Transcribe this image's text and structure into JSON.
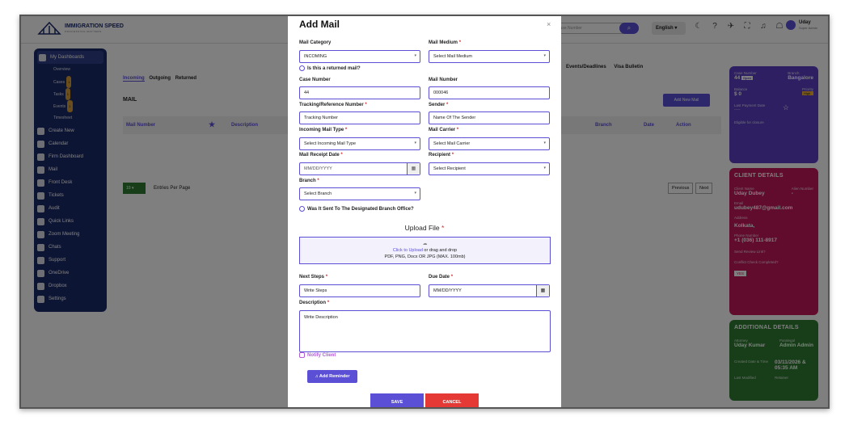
{
  "app": {
    "logo_text": "IMMIGRATION SPEED",
    "logo_sub": "PROCESSING MATTERS",
    "search_placeholder": "Case Number",
    "language": "English",
    "user_name": "Uday",
    "user_role": "Super Admin"
  },
  "sidebar": {
    "items": [
      {
        "label": "My Dashboards"
      },
      {
        "label": "Create New"
      },
      {
        "label": "Calendar"
      },
      {
        "label": "Firm Dashboard"
      },
      {
        "label": "Mail"
      },
      {
        "label": "Front Desk"
      },
      {
        "label": "Tickets"
      },
      {
        "label": "Audit"
      },
      {
        "label": "Quick Links"
      },
      {
        "label": "Zoom Meeting"
      },
      {
        "label": "Chats"
      },
      {
        "label": "Support"
      },
      {
        "label": "OneDrive"
      },
      {
        "label": "Dropbox"
      },
      {
        "label": "Settings"
      }
    ],
    "subitems": [
      {
        "label": "Overview",
        "badge": ""
      },
      {
        "label": "Cases",
        "badge": "1"
      },
      {
        "label": "Tasks",
        "badge": "1"
      },
      {
        "label": "Events",
        "badge": "1"
      },
      {
        "label": "Timesheet",
        "badge": ""
      }
    ]
  },
  "main": {
    "tabs": [
      "Incoming",
      "Outgoing",
      "Returned"
    ],
    "section_title": "MAIL",
    "add_button": "Add New Mail",
    "headers": [
      "Mail Number",
      "Description",
      "Branch",
      "Date",
      "Action"
    ],
    "page_size": "10",
    "entries_label": "Entries Per Page",
    "prev": "Previous",
    "next": "Next",
    "top_tabs": [
      "Events/Deadlines",
      "Visa Bulletin"
    ]
  },
  "case_card": {
    "case_number_label": "Case Number",
    "case_number": "44",
    "status": "Open",
    "branch_label": "Branch",
    "branch": "Bangalore",
    "balance_label": "Balance",
    "balance": "$ 0",
    "priority_label": "Priority",
    "priority": "High",
    "last_payment_label": "Last Payment Date",
    "last_payment": "-----",
    "closure": "Eligible for closure"
  },
  "client_card": {
    "title": "CLIENT DETAILS",
    "name_label": "Client Name",
    "name": "Uday Dubey",
    "alien_label": "Alien Number",
    "alien": "-",
    "email_label": "Email",
    "email": "udubey487@gmail.com",
    "address_label": "Address",
    "address": "Kolkata,",
    "phone_label": "Phone Number",
    "phone": "+1 (036) 111-8917",
    "review": "Send Review Link?",
    "conflict": "Conflict Check Completed?",
    "conflict_value": "YES"
  },
  "additional_card": {
    "title": "ADDITIONAL DETAILS",
    "attorney_label": "Attorney",
    "attorney": "Uday Kumar",
    "paralegal_label": "Paralegal",
    "paralegal": "Admin Admin",
    "created_label": "Created Date & Time",
    "created": "03/11/2026 & 05:35 AM",
    "modified_label": "Last Modified",
    "modified_right": "Retainer"
  },
  "modal": {
    "title": "Add Mail",
    "mail_category_label": "Mail Category",
    "mail_category": "INCOMING",
    "mail_medium_label": "Mail Medium",
    "mail_medium": "Select Mail Medium",
    "returned_check": "Is this a returned mail?",
    "case_number_label": "Case Number",
    "case_number": "44",
    "mail_number_label": "Mail Number",
    "mail_number": "000046",
    "tracking_label": "Tracking/Reference Number",
    "tracking_placeholder": "Tracking Number",
    "sender_label": "Sender",
    "sender_placeholder": "Name Of The Sender",
    "incoming_type_label": "Incoming Mail Type",
    "incoming_type": "Select Incoming Mail Type",
    "carrier_label": "Mail Carrier",
    "carrier": "Select Mail Carrier",
    "receipt_date_label": "Mail Receipt Date",
    "receipt_date_placeholder": "MM/DD/YYYY",
    "recipient_label": "Recipient",
    "recipient": "Select Recipient",
    "branch_label": "Branch",
    "branch": "Select Branch",
    "branch_check": "Was It Sent To The Designated Branch Office?",
    "upload_title": "Upload File",
    "upload_link": "Click to Upload",
    "upload_text": " or drag and drop",
    "upload_formats": "PDF, PNG, Docx OR JPG (MAX. 100mb)",
    "next_steps_label": "Next Steps",
    "next_steps_placeholder": "Write Steps",
    "due_date_label": "Due Date",
    "due_date_placeholder": "MM/DD/YYYY",
    "description_label": "Description",
    "description_placeholder": "Write Description",
    "notify": "Notify Client",
    "add_reminder": "Add Reminder",
    "save": "SAVE",
    "cancel": "CANCEL",
    "req_mark": "*"
  },
  "colors": {
    "accent": "#5b4fd6",
    "navy": "#1b2a6b",
    "danger": "#e53935"
  }
}
